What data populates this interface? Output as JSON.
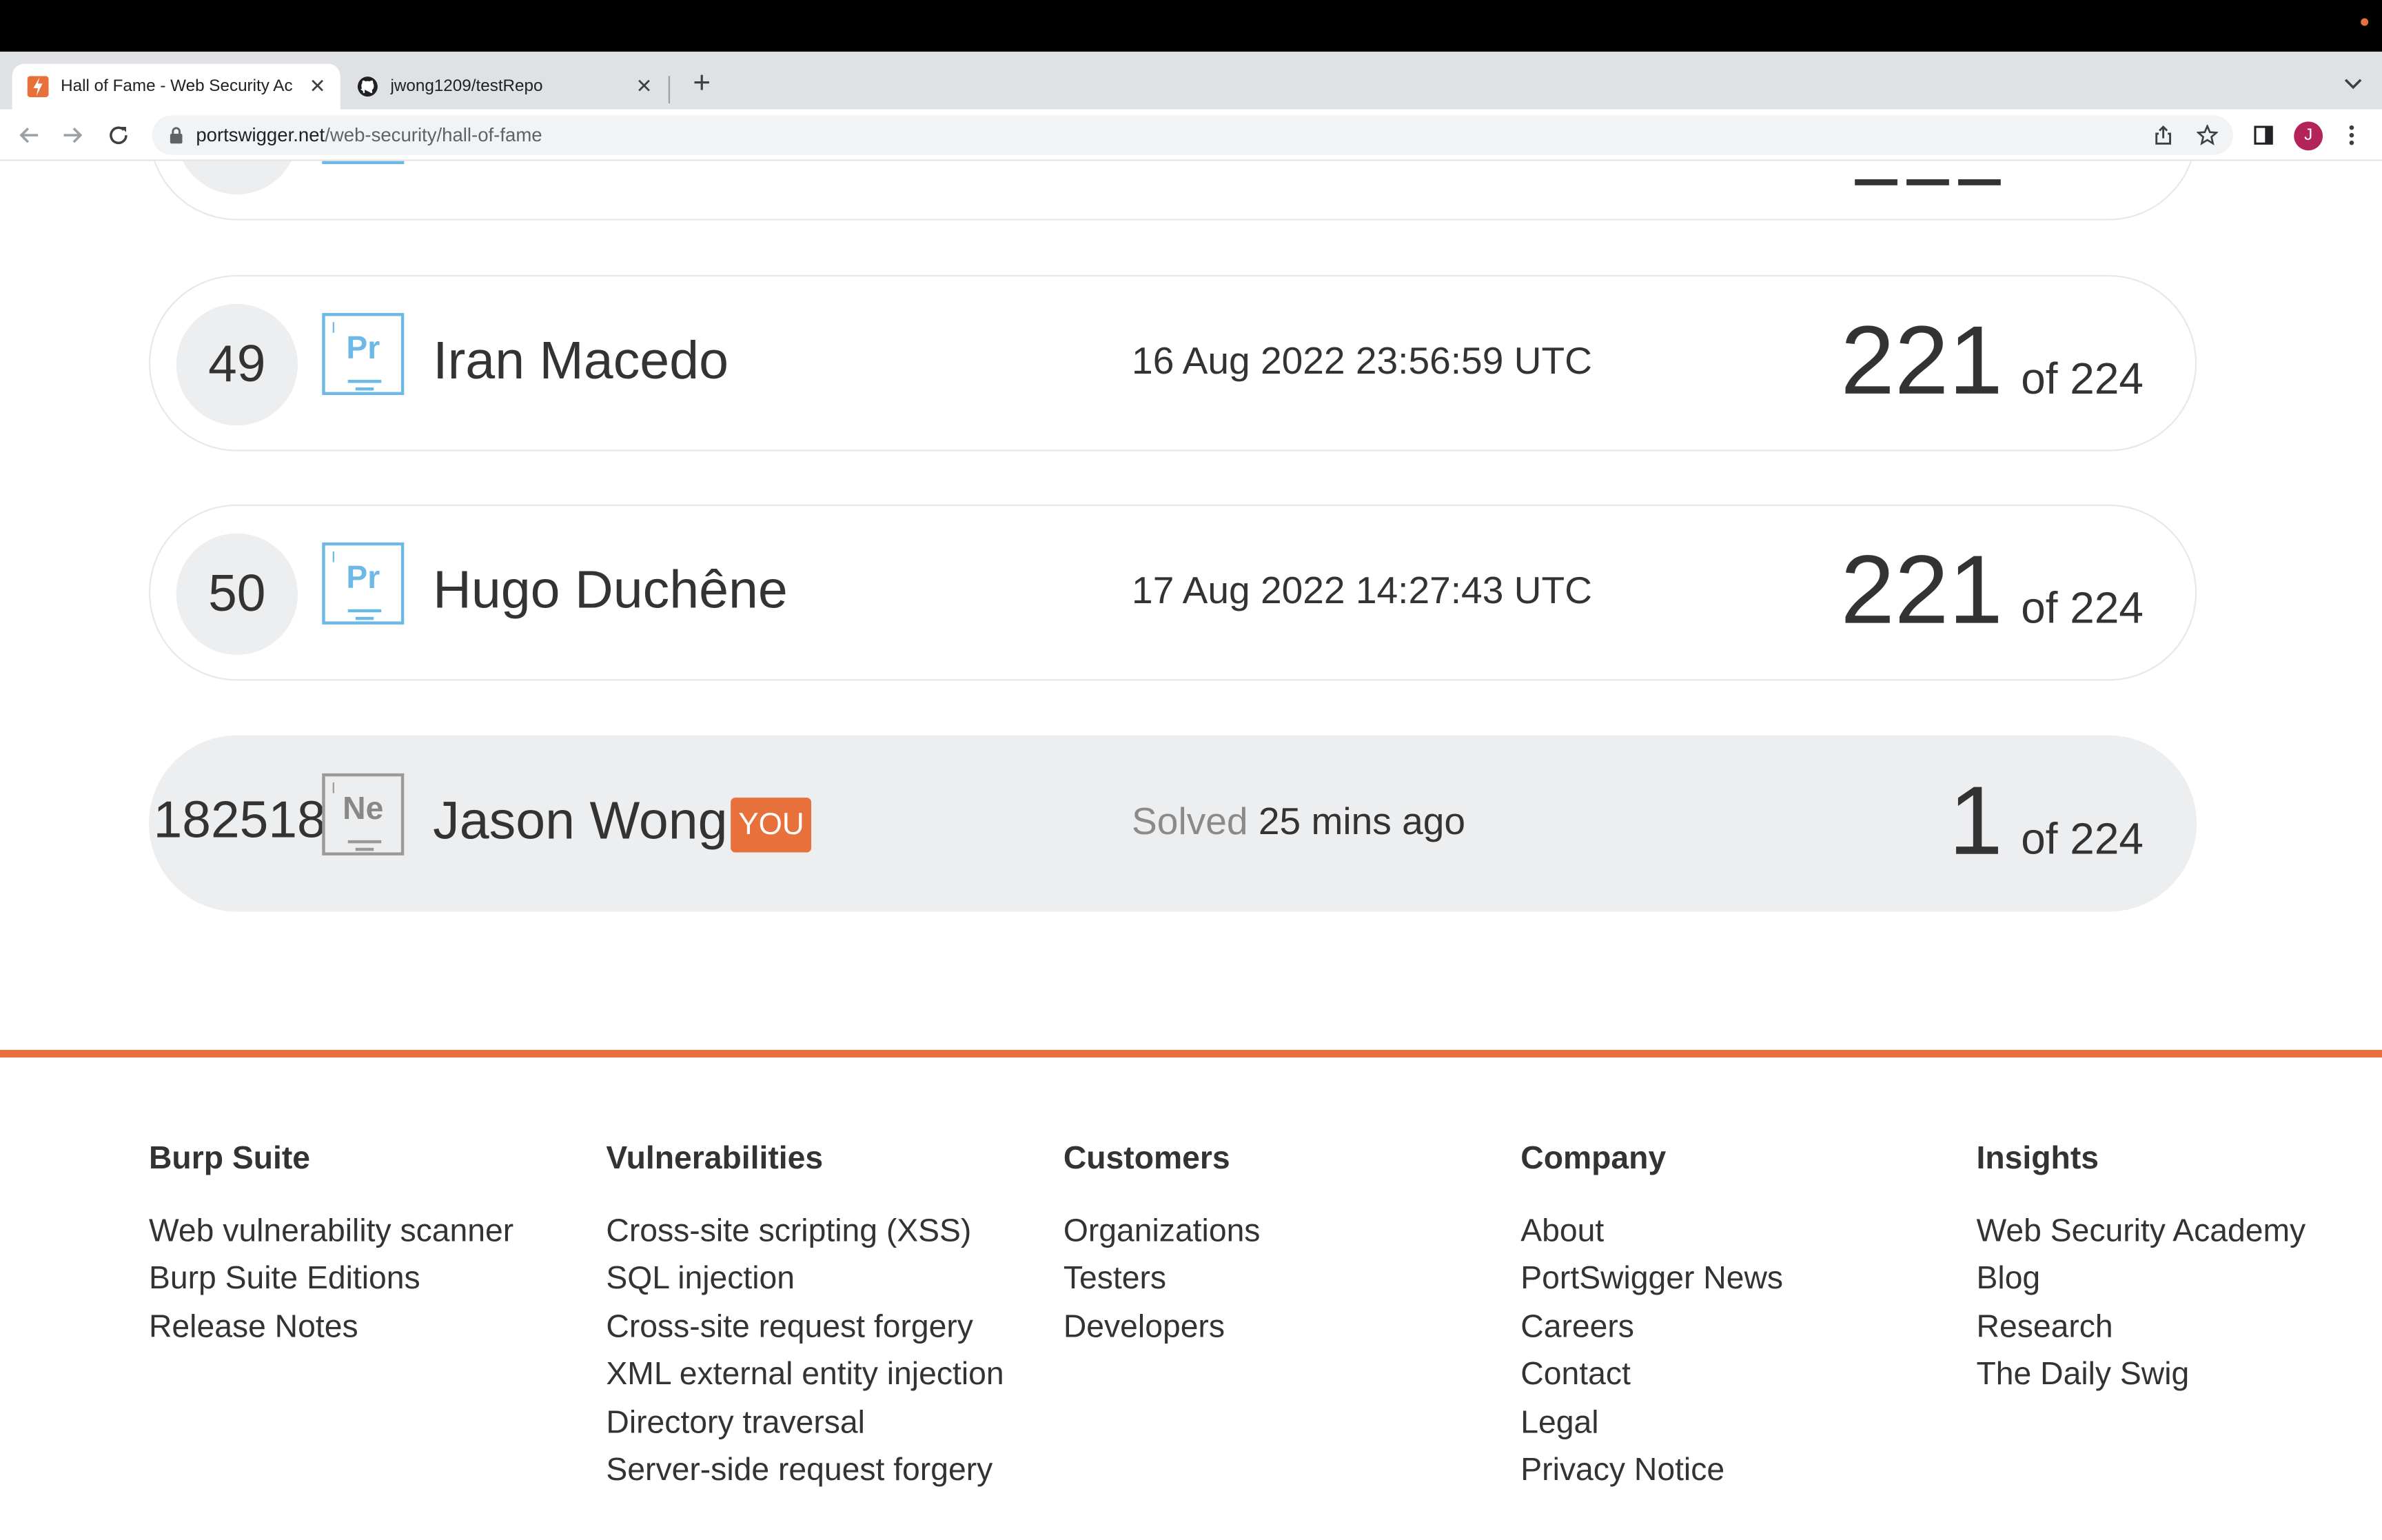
{
  "browser": {
    "tabs": [
      {
        "title": "Hall of Fame - Web Security Ac",
        "active": true,
        "icon": "portswigger-icon"
      },
      {
        "title": "jwong1209/testRepo",
        "active": false,
        "icon": "github-icon"
      }
    ],
    "url": {
      "domain": "portswigger.net",
      "path": "/web-security/hall-of-fame"
    },
    "profile_initial": "J",
    "accent": "#e8703a",
    "avatar_color": "#b3245b"
  },
  "leaderboard": {
    "rows": [
      {
        "rank": "49",
        "badge": "Pr",
        "name": "Iran Macedo",
        "date": "16 Aug 2022 23:56:59 UTC",
        "solved": "221",
        "total": "of 224"
      },
      {
        "rank": "50",
        "badge": "Pr",
        "name": "Hugo Duchêne",
        "date": "17 Aug 2022 14:27:43 UTC",
        "solved": "221",
        "total": "of 224"
      }
    ],
    "current_user": {
      "rank": "182518",
      "badge": "Ne",
      "name": "Jason Wong",
      "you_label": "YOU",
      "solved_prefix": "Solved",
      "solved_when": "25 mins ago",
      "solved": "1",
      "total": "of 224"
    }
  },
  "footer": {
    "columns": [
      {
        "heading": "Burp Suite",
        "links": [
          "Web vulnerability scanner",
          "Burp Suite Editions",
          "Release Notes"
        ]
      },
      {
        "heading": "Vulnerabilities",
        "links": [
          "Cross-site scripting (XSS)",
          "SQL injection",
          "Cross-site request forgery",
          "XML external entity injection",
          "Directory traversal",
          "Server-side request forgery"
        ]
      },
      {
        "heading": "Customers",
        "links": [
          "Organizations",
          "Testers",
          "Developers"
        ]
      },
      {
        "heading": "Company",
        "links": [
          "About",
          "PortSwigger News",
          "Careers",
          "Contact",
          "Legal",
          "Privacy Notice"
        ]
      },
      {
        "heading": "Insights",
        "links": [
          "Web Security Academy",
          "Blog",
          "Research",
          "The Daily Swig"
        ]
      }
    ]
  }
}
